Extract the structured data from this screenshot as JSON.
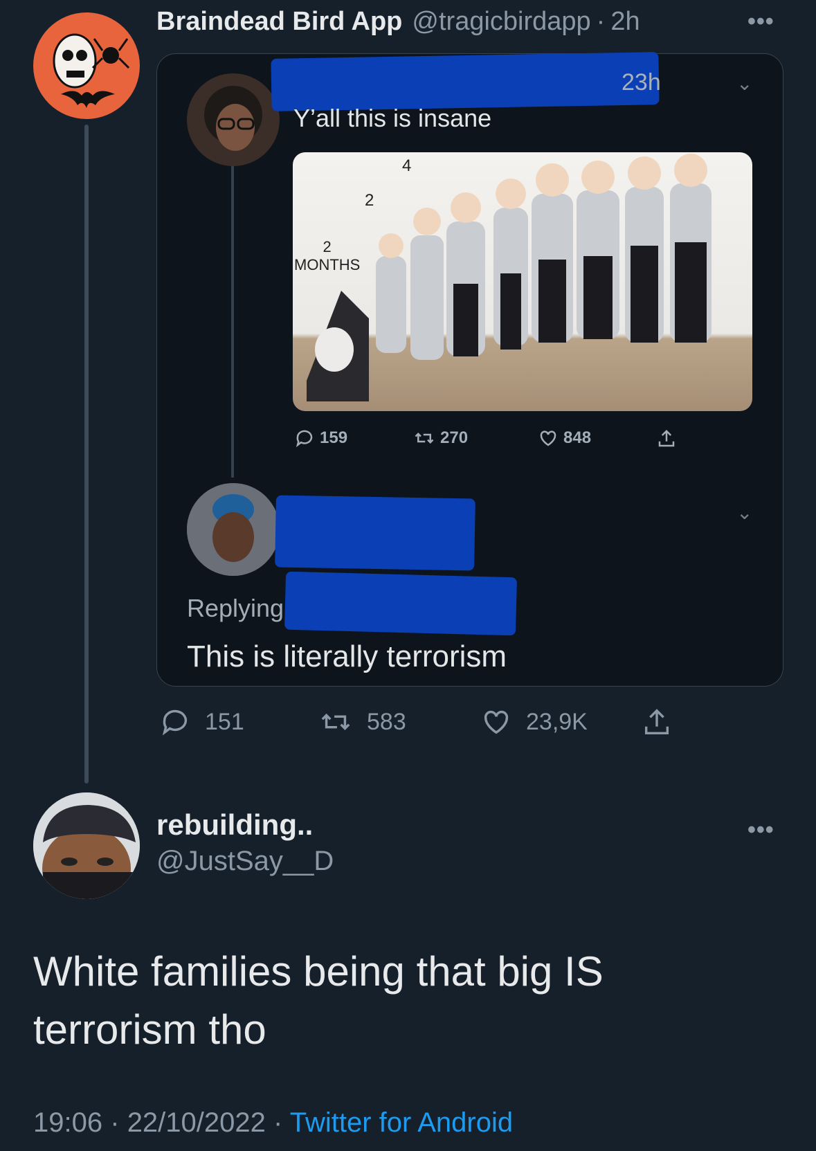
{
  "colors": {
    "background": "#15202b",
    "link": "#1d9bf0",
    "redaction": "#0a3fb5",
    "avatar_orange": "#e8643c"
  },
  "main_tweet": {
    "display_name": "Braindead Bird App",
    "handle": "@tragicbirdapp",
    "separator": "·",
    "time": "2h",
    "more_icon": "more-horizontal-icon",
    "actions": {
      "replies": "151",
      "retweets": "583",
      "likes": "23,9K"
    }
  },
  "quoted_screenshot": {
    "tweet_1": {
      "time": "23h",
      "text": "Y’all this is insane",
      "photo_labels": {
        "label_4": "4",
        "label_2": "2",
        "label_months": "2\nMONTHS"
      },
      "actions": {
        "replies": "159",
        "retweets": "270",
        "likes": "848"
      }
    },
    "tweet_2": {
      "replying": "Replying",
      "text": "This is literally terrorism"
    }
  },
  "reply_tweet": {
    "display_name": "rebuilding..",
    "handle": "@JustSay__D",
    "text": "White families being that big IS terrorism tho",
    "time": "19:06",
    "separator": "·",
    "date": "22/10/2022",
    "source": "Twitter for Android"
  }
}
